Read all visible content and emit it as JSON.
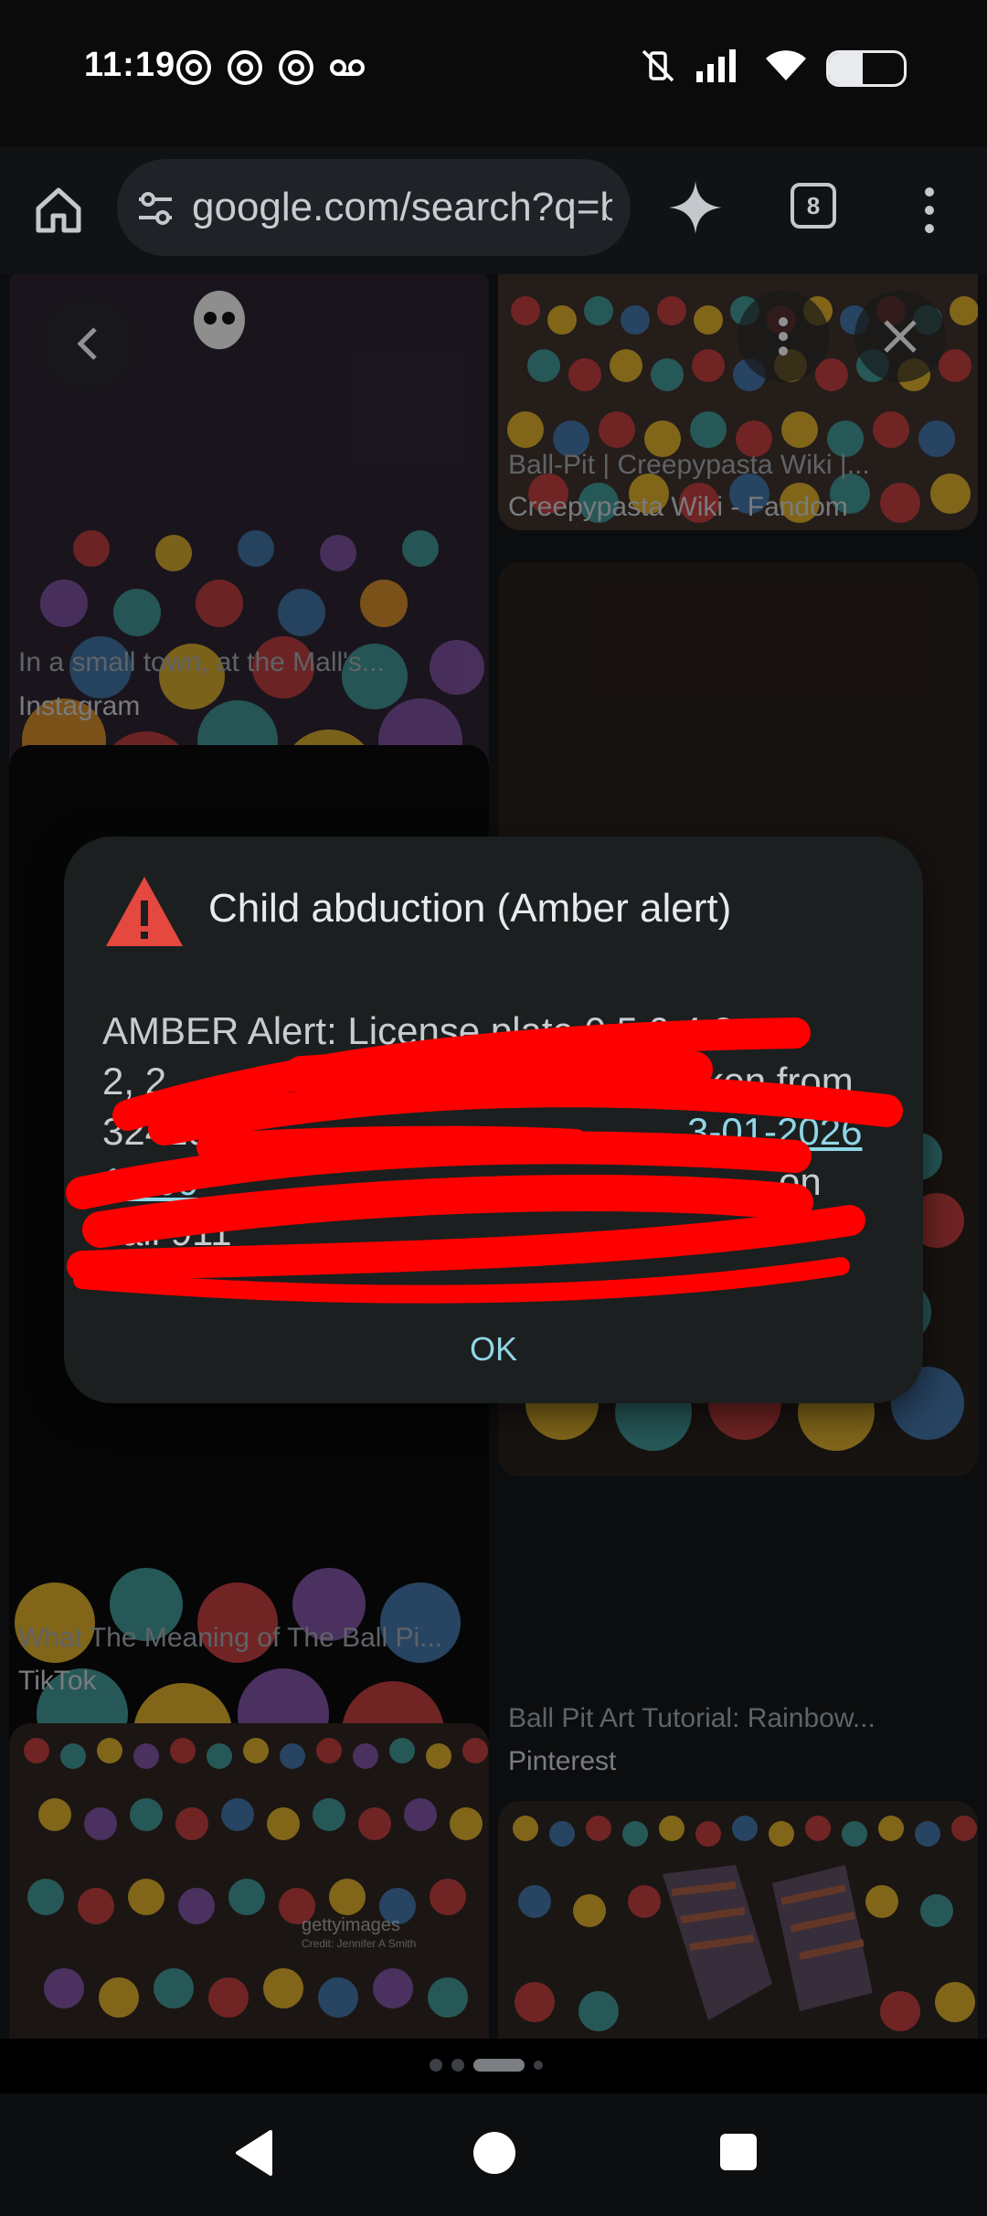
{
  "status_bar": {
    "time": "11:19",
    "battery_level": 0.45
  },
  "browser": {
    "url": "google.com/search?q=b",
    "tab_count": "8"
  },
  "results": [
    {
      "caption": "In a small town, at the Mall's...",
      "source": "Instagram"
    },
    {
      "caption": "Ball-Pit | Creepypasta Wiki |...",
      "source": "Creepypasta Wiki - Fandom"
    },
    {
      "caption": "What The Meaning of The Ball Pi...",
      "source": "TikTok"
    },
    {
      "caption": "Ball Pit Art Tutorial: Rainbow...",
      "source": "Pinterest"
    }
  ],
  "watermark": {
    "brand": "gettyimages",
    "credit": "Credit: Jennifer A Smith"
  },
  "dialog": {
    "title": "Child abduction (Amber alert)",
    "body_lines": [
      "AMBER Alert:  License plate  0 5 0 4 2",
      "2,  2",
      "32429 R",
      "12:00",
      "call 911"
    ],
    "visible_fragments": [
      "Taken from",
      "3-01-2026",
      "on"
    ],
    "ok_label": "OK"
  },
  "colors": {
    "accent": "#8fd6e6",
    "warning": "#e5483f",
    "redaction": "#ff0000"
  },
  "icons": {
    "home": "home-icon",
    "site_info": "tune-icon",
    "gemini": "sparkle-icon",
    "menu": "more-vert-icon",
    "back": "chevron-left-icon",
    "close": "close-icon",
    "warning": "warning-triangle-icon"
  }
}
